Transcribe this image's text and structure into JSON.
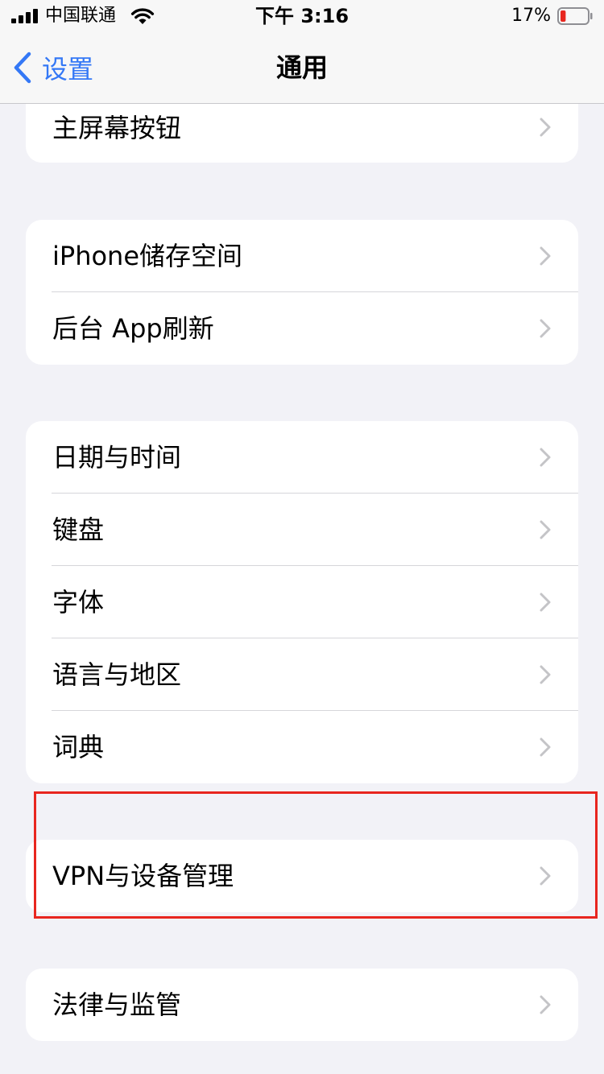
{
  "status_bar": {
    "carrier": "中国联通",
    "time": "下午 3:16",
    "battery_percent": "17%",
    "battery_level": 0.17,
    "icons": [
      "signal-icon",
      "wifi-icon",
      "battery-icon"
    ]
  },
  "nav": {
    "back_label": "设置",
    "title": "通用",
    "back_icon": "chevron-left-icon"
  },
  "groups": [
    {
      "items": [
        {
          "label": "主屏幕按钮"
        }
      ]
    },
    {
      "items": [
        {
          "label": "iPhone储存空间"
        },
        {
          "label": "后台 App刷新"
        }
      ]
    },
    {
      "items": [
        {
          "label": "日期与时间"
        },
        {
          "label": "键盘"
        },
        {
          "label": "字体"
        },
        {
          "label": "语言与地区"
        },
        {
          "label": "词典"
        }
      ]
    },
    {
      "items": [
        {
          "label": "VPN与设备管理"
        }
      ]
    },
    {
      "items": [
        {
          "label": "法律与监管"
        }
      ]
    }
  ],
  "colors": {
    "accent": "#3478f6",
    "background": "#f2f2f7",
    "highlight": "#e8261f",
    "chevron": "#c4c4c7"
  }
}
